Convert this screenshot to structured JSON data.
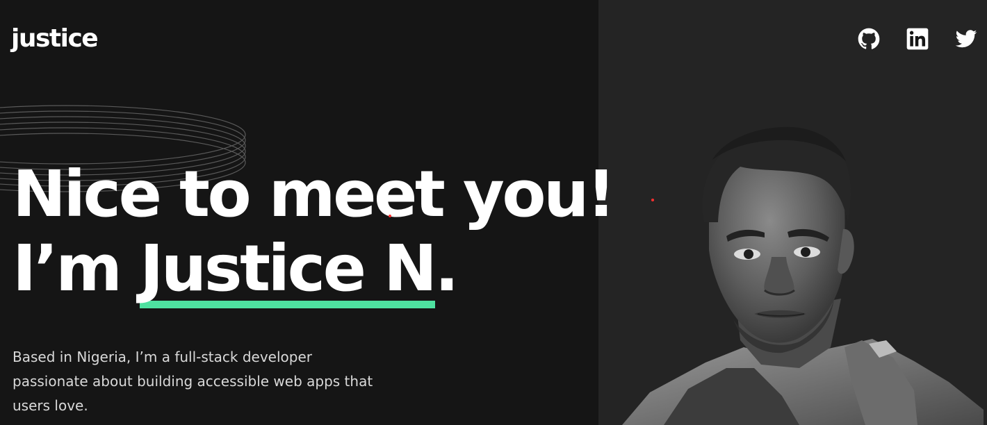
{
  "header": {
    "logo": "justice",
    "socials": [
      {
        "name": "GitHub",
        "icon": "github-icon"
      },
      {
        "name": "LinkedIn",
        "icon": "linkedin-icon"
      },
      {
        "name": "Twitter",
        "icon": "twitter-icon"
      }
    ]
  },
  "hero": {
    "line1": "Nice to meet you!",
    "line2_prefix": "I’m ",
    "name": "Justice N",
    "line2_suffix": ".",
    "intro": "Based in Nigeria, I’m a full-stack developer passionate about building accessible web apps that users love."
  },
  "colors": {
    "background": "#151515",
    "panel": "#242424",
    "accent": "#4ee1a0",
    "text": "#ffffff",
    "body_text": "#d9d9d9"
  }
}
